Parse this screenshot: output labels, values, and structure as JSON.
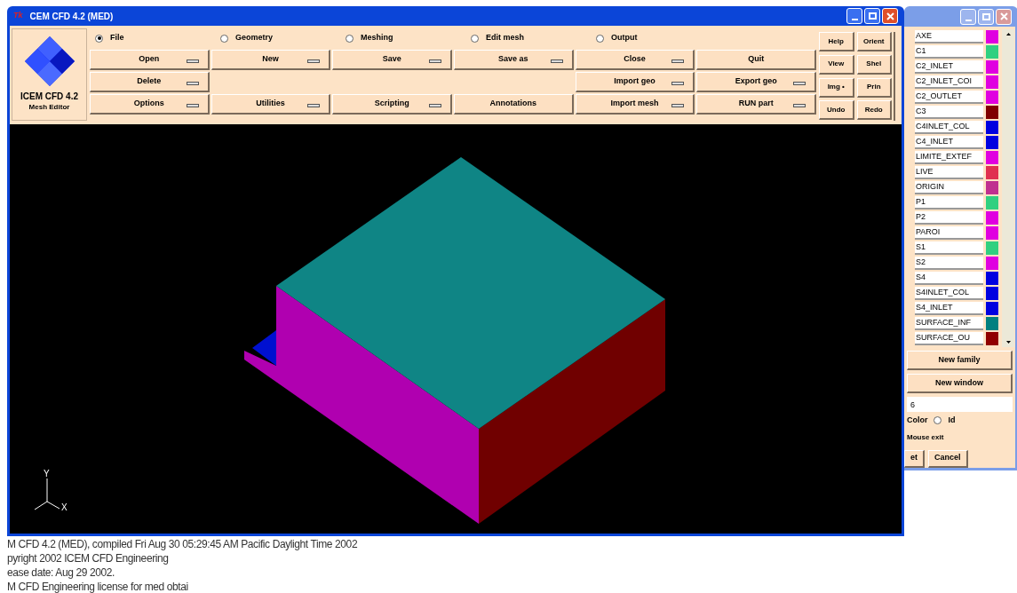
{
  "main_window": {
    "title": "CEM CFD 4.2 (MED)",
    "title_icon": "Tk",
    "logo": {
      "lines": [
        "ICEM CFD 4.2",
        "Mesh Editor"
      ]
    },
    "radios": [
      {
        "label": "File",
        "selected": true
      },
      {
        "label": "Geometry",
        "selected": false
      },
      {
        "label": "Meshing",
        "selected": false
      },
      {
        "label": "Edit mesh",
        "selected": false
      },
      {
        "label": "Output",
        "selected": false
      }
    ],
    "button_rows": [
      [
        {
          "label": "Open",
          "menu": true
        },
        {
          "label": "New",
          "menu": true
        },
        {
          "label": "Save",
          "menu": true
        },
        {
          "label": "Save as",
          "menu": true
        },
        {
          "label": "Close",
          "menu": true
        },
        {
          "label": "Quit",
          "menu": false
        }
      ],
      [
        {
          "label": "Delete",
          "menu": true
        },
        null,
        null,
        null,
        {
          "label": "Import geo",
          "menu": true
        },
        {
          "label": "Export geo",
          "menu": true
        }
      ],
      [
        {
          "label": "Options",
          "menu": true
        },
        {
          "label": "Utilities",
          "menu": true
        },
        {
          "label": "Scripting",
          "menu": true
        },
        {
          "label": "Annotations",
          "menu": false
        },
        {
          "label": "Import mesh",
          "menu": true
        },
        {
          "label": "RUN part",
          "menu": true
        }
      ]
    ],
    "side_buttons": [
      "Help",
      "Orient",
      "View",
      "Shel",
      "Img •",
      "Prin",
      "Undo",
      "Redo"
    ],
    "axes": {
      "y": "Y",
      "x": "X"
    }
  },
  "family_window": {
    "families": [
      {
        "name": "AXE",
        "color": "#e000e0"
      },
      {
        "name": "C1",
        "color": "#30d080"
      },
      {
        "name": "C2_INLET",
        "color": "#e000e0"
      },
      {
        "name": "C2_INLET_COI",
        "color": "#e000e0"
      },
      {
        "name": "C2_OUTLET",
        "color": "#e000e0"
      },
      {
        "name": "C3",
        "color": "#800000"
      },
      {
        "name": "C4INLET_COL",
        "color": "#0000e0"
      },
      {
        "name": "C4_INLET",
        "color": "#0000e0"
      },
      {
        "name": "LIMITE_EXTEF",
        "color": "#e000e0"
      },
      {
        "name": "LIVE",
        "color": "#e03050"
      },
      {
        "name": "ORIGIN",
        "color": "#c03090"
      },
      {
        "name": "P1",
        "color": "#30d080"
      },
      {
        "name": "P2",
        "color": "#e000e0"
      },
      {
        "name": "PAROI",
        "color": "#e000e0"
      },
      {
        "name": "S1",
        "color": "#30d080"
      },
      {
        "name": "S2",
        "color": "#e000e0"
      },
      {
        "name": "S4",
        "color": "#0000e0"
      },
      {
        "name": "S4INLET_COL",
        "color": "#0000e0"
      },
      {
        "name": "S4_INLET",
        "color": "#0000e0"
      },
      {
        "name": "SURFACE_INF",
        "color": "#008080"
      },
      {
        "name": "SURFACE_OU",
        "color": "#900000"
      }
    ],
    "buttons": [
      "New family",
      "New window"
    ],
    "field_value": "6",
    "color_label": "Color",
    "id_radio": {
      "label": "Id",
      "selected": false
    },
    "mouse_label": "Mouse exit",
    "bottom_buttons": [
      "et",
      "Cancel"
    ]
  },
  "console_lines": [
    "M CFD 4.2 (MED), compiled Fri Aug 30 05:29:45 AM Pacific Daylight Time 2002",
    "pyright 2002 ICEM CFD Engineering",
    "ease date: Aug 29 2002.",
    "M CFD Engineering license for med obtai"
  ]
}
